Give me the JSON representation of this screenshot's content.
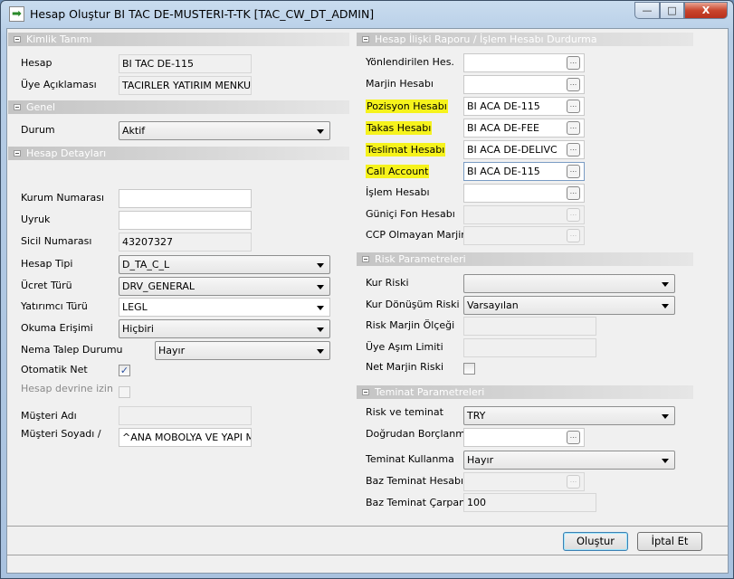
{
  "window": {
    "title": "Hesap Oluştur BI TAC DE-MUSTERI-T-TK [TAC_CW_DT_ADMIN]",
    "minimize": "—",
    "maximize": "□",
    "close": "X"
  },
  "highlight_color": "#f6f31c",
  "left": {
    "kimlik": {
      "title": "Kimlik Tanımı",
      "hesap_label": "Hesap",
      "hesap_value": "BI TAC DE-115",
      "uye_label": "Üye Açıklaması",
      "uye_value": "TACIRLER YATIRIM MENKUL D"
    },
    "genel": {
      "title": "Genel",
      "durum_label": "Durum",
      "durum_value": "Aktif"
    },
    "detay": {
      "title": "Hesap Detayları",
      "kurum_label": "Kurum Numarası",
      "kurum_value": "",
      "uyruk_label": "Uyruk",
      "uyruk_value": "",
      "sicil_label": "Sicil Numarası",
      "sicil_value": "43207327",
      "hesap_tipi_label": "Hesap Tipi",
      "hesap_tipi_value": "D_TA_C_L",
      "ucret_label": "Ücret Türü",
      "ucret_value": "DRV_GENERAL",
      "yatirimci_label": "Yatırımcı Türü",
      "yatirimci_value": "LEGL",
      "okuma_label": "Okuma Erişimi",
      "okuma_value": "Hiçbiri",
      "nema_label": "Nema Talep Durumu",
      "nema_value": "Hayır",
      "otomatik_label": "Otomatik Net",
      "otomatik_checked": true,
      "devir_label": "Hesap devrine izin",
      "devir_checked": false,
      "musteri_adi_label": "Müşteri Adı",
      "musteri_adi_value": "",
      "musteri_soyadi_label": "Müşteri Soyadı /",
      "musteri_soyadi_value": "^ANA MOBOLYA VE YAPI MAL"
    }
  },
  "right": {
    "iliski": {
      "title": "Hesap İlişki Raporu / İşlem Hesabı Durdurma",
      "rows": [
        {
          "label": "Yönlendirilen Hes.",
          "value": "",
          "highlight": false,
          "disabled": false
        },
        {
          "label": "Marjin Hesabı",
          "value": "",
          "highlight": false,
          "disabled": false
        },
        {
          "label": "Pozisyon Hesabı",
          "value": "BI ACA DE-115",
          "highlight": true,
          "disabled": false
        },
        {
          "label": "Takas Hesabı",
          "value": "BI ACA DE-FEE",
          "highlight": true,
          "disabled": false
        },
        {
          "label": "Teslimat Hesabı",
          "value": "BI ACA DE-DELIVC",
          "highlight": true,
          "disabled": false
        },
        {
          "label": "Call Account",
          "value": "BI ACA DE-115",
          "highlight": true,
          "disabled": false
        },
        {
          "label": "İşlem Hesabı",
          "value": "",
          "highlight": false,
          "disabled": false
        },
        {
          "label": "Güniçi Fon Hesabı",
          "value": "",
          "highlight": false,
          "disabled": true
        },
        {
          "label": "CCP Olmayan Marjin",
          "value": "",
          "highlight": false,
          "disabled": true
        }
      ],
      "browse_label": "..."
    },
    "risk": {
      "title": "Risk Parametreleri",
      "kur_label": "Kur Riski",
      "kur_value": "",
      "kur_donusum_label": "Kur Dönüşüm Riski",
      "kur_donusum_value": "Varsayılan",
      "marjin_olcegi_label": "Risk Marjin Ölçeği",
      "marjin_olcegi_value": "",
      "asim_label": "Üye Aşım Limiti",
      "asim_value": "",
      "net_marjin_label": "Net Marjin Riski",
      "net_marjin_checked": false
    },
    "teminat": {
      "title": "Teminat Parametreleri",
      "risk_teminat_label": "Risk ve teminat",
      "risk_teminat_value": "TRY",
      "dogrudan_label": "Doğrudan Borçlanma",
      "dogrudan_value": "",
      "kullanma_label": "Teminat Kullanma",
      "kullanma_value": "Hayır",
      "baz_hesap_label": "Baz Teminat Hesabı",
      "baz_hesap_value": "",
      "carpan_label": "Baz Teminat Çarpanı",
      "carpan_value": "100"
    }
  },
  "footer": {
    "create_label": "Oluştur",
    "cancel_label": "İptal Et"
  }
}
